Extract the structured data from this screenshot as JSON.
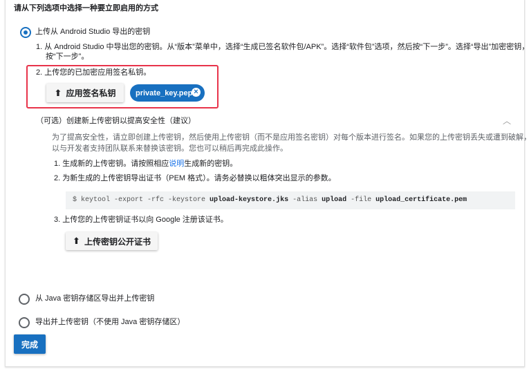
{
  "heading": "请从下列选项中选择一种要立即启用的方式",
  "option1": {
    "label": "上传从 Android Studio 导出的密钥",
    "selected": true,
    "step1_line1": "1.  从 Android Studio 中导出您的密钥。从“版本”菜单中，选择“生成已签名软件包/APK”。选择“软件包”选项，然后按“下一步”。选择“导出”加密密钥，然后",
    "step1_line2": "按“下一步”。",
    "step2": "2.  上传您的已加密应用签名私钥。",
    "upload_button": "应用签名私钥",
    "file_chip": "private_key.pepk"
  },
  "optional": {
    "title": "（可选）创建新上传密钥以提高安全性（建议）",
    "para_line1": "为了提高安全性，请立即创建上传密钥，然后使用上传密钥（而不是应用签名密钥）对每个版本进行签名。如果您的上传密钥丢失或遭到破解，您可",
    "para_line2": "以与开发者支持团队联系来替换该密钥。您也可以稍后再完成此操作。",
    "step1_pre": "1.  生成新的上传密钥。请按照相应",
    "step1_link": "说明",
    "step1_post": "生成新的密钥。",
    "step2": "2.  为新生成的上传密钥导出证书（PEM 格式）。请务必替换以粗体突出显示的参数。",
    "code": {
      "p1": "$ keytool -export -rfc -keystore ",
      "b1": "upload-keystore.jks",
      "p2": " -alias ",
      "b2": "upload",
      "p3": " -file ",
      "b3": "upload_certificate.pem"
    },
    "step3": "3.  上传您的上传密钥证书以向 Google 注册该证书。",
    "upload_button": "上传密钥公开证书"
  },
  "option2": {
    "label": "从 Java 密钥存储区导出并上传密钥",
    "selected": false
  },
  "option3": {
    "label": "导出并上传密钥（不使用 Java 密钥存储区）",
    "selected": false
  },
  "done_button": "完成"
}
